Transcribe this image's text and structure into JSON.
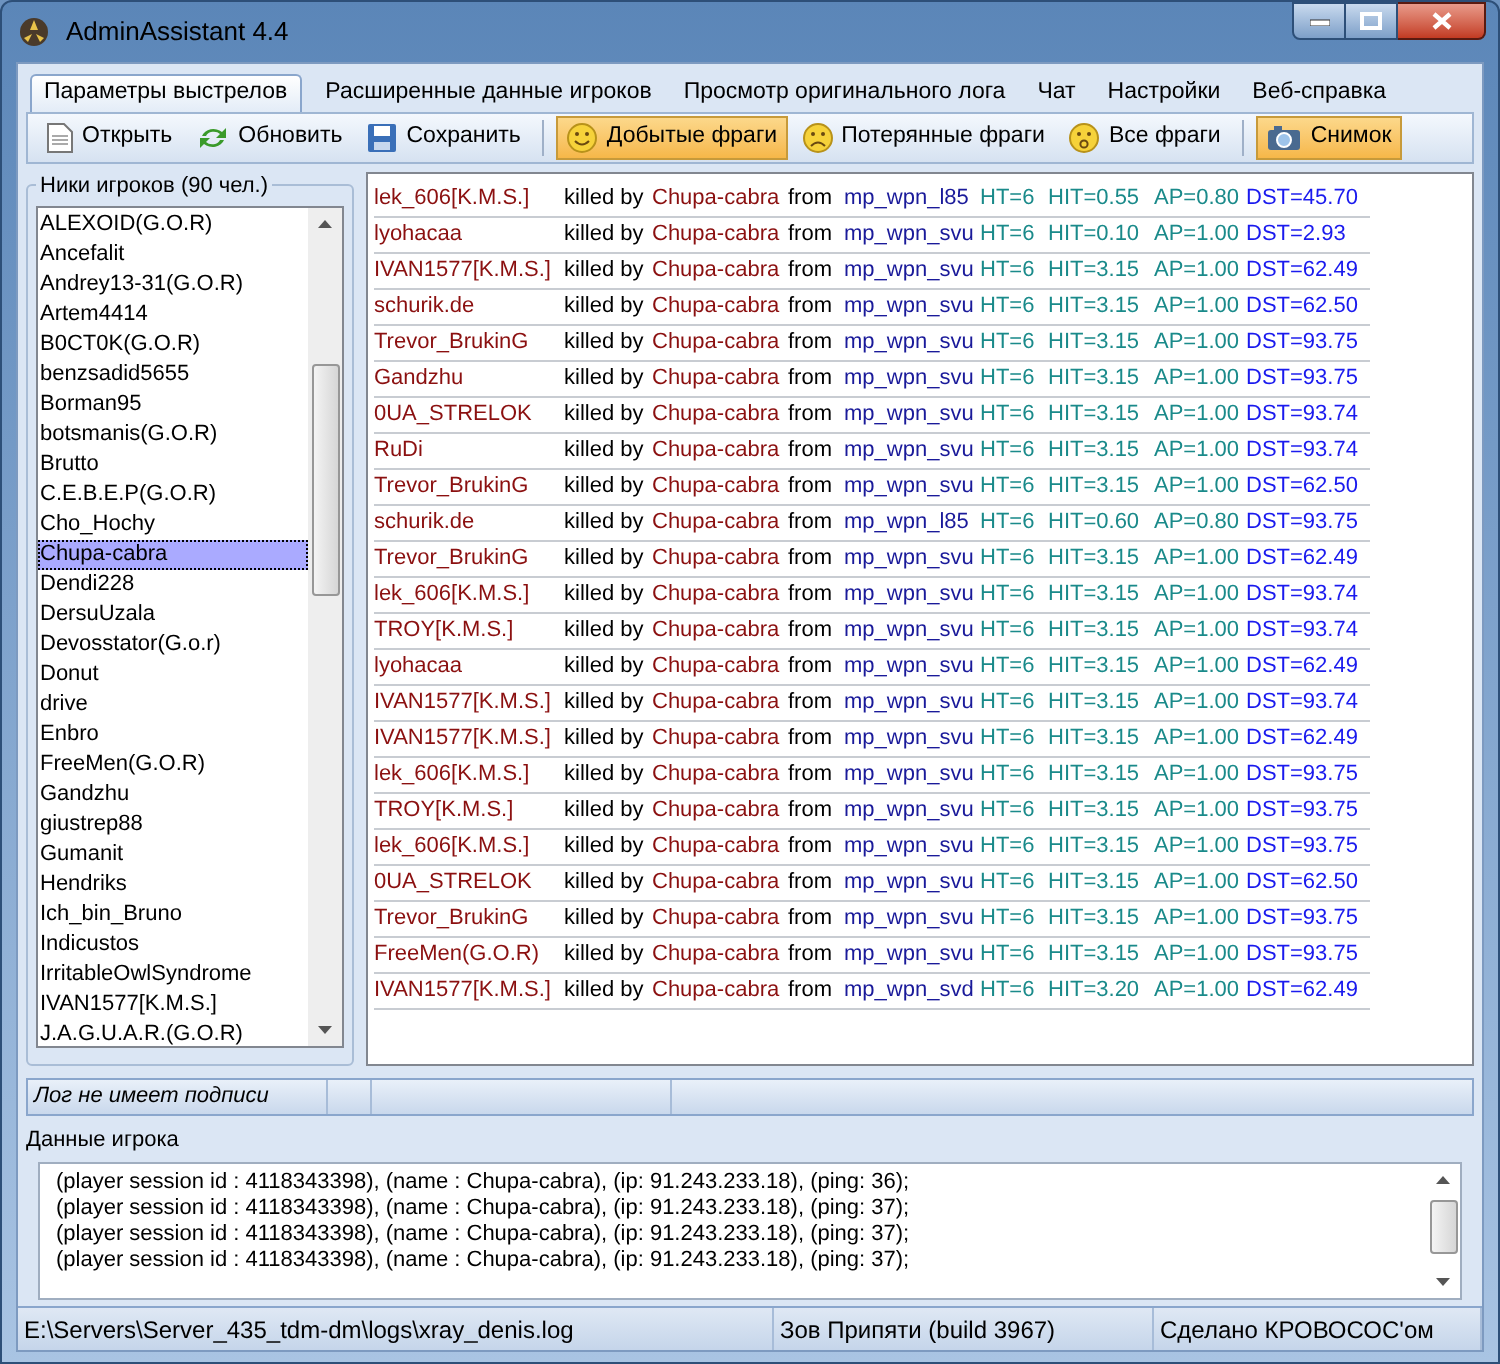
{
  "window": {
    "title": "AdminAssistant 4.4"
  },
  "tabs": [
    {
      "label": "Параметры выстрелов",
      "selected": true
    },
    {
      "label": "Расширенные данные игроков",
      "selected": false
    },
    {
      "label": "Просмотр оригинального лога",
      "selected": false
    },
    {
      "label": "Чат",
      "selected": false
    },
    {
      "label": "Настройки",
      "selected": false
    },
    {
      "label": "Веб-справка",
      "selected": false
    }
  ],
  "toolbar": [
    {
      "kind": "open",
      "label": "Открыть",
      "pressed": false
    },
    {
      "kind": "refresh",
      "label": "Обновить",
      "pressed": false
    },
    {
      "kind": "save",
      "label": "Сохранить",
      "pressed": false
    },
    {
      "kind": "separator"
    },
    {
      "kind": "happy",
      "label": "Добытые фраги",
      "pressed": true
    },
    {
      "kind": "sad",
      "label": "Потерянные фраги",
      "pressed": false
    },
    {
      "kind": "neutral",
      "label": "Все фраги",
      "pressed": false
    },
    {
      "kind": "separator"
    },
    {
      "kind": "camera",
      "label": "Снимок",
      "pressed": true
    }
  ],
  "players": {
    "title": "Ники игроков (90 чел.)",
    "items": [
      {
        "name": "ALEXOID(G.O.R)",
        "selected": false
      },
      {
        "name": "Ancefalit",
        "selected": false
      },
      {
        "name": "Andrey13-31(G.O.R)",
        "selected": false
      },
      {
        "name": "Artem4414",
        "selected": false
      },
      {
        "name": "B0CT0K(G.O.R)",
        "selected": false
      },
      {
        "name": "benzsadid5655",
        "selected": false
      },
      {
        "name": "Borman95",
        "selected": false
      },
      {
        "name": "botsmanis(G.O.R)",
        "selected": false
      },
      {
        "name": "Brutto",
        "selected": false
      },
      {
        "name": "C.E.B.E.P(G.O.R)",
        "selected": false
      },
      {
        "name": "Cho_Hochy",
        "selected": false
      },
      {
        "name": "Chupa-cabra",
        "selected": true
      },
      {
        "name": "Dendi228",
        "selected": false
      },
      {
        "name": "DersuUzala",
        "selected": false
      },
      {
        "name": "Devosstator(G.o.r)",
        "selected": false
      },
      {
        "name": "Donut",
        "selected": false
      },
      {
        "name": "drive",
        "selected": false
      },
      {
        "name": "Enbro",
        "selected": false
      },
      {
        "name": "FreeMen(G.O.R)",
        "selected": false
      },
      {
        "name": "Gandzhu",
        "selected": false
      },
      {
        "name": "giustrep88",
        "selected": false
      },
      {
        "name": "Gumanit",
        "selected": false
      },
      {
        "name": "Hendriks",
        "selected": false
      },
      {
        "name": "Ich_bin_Bruno",
        "selected": false
      },
      {
        "name": "Indicustos",
        "selected": false
      },
      {
        "name": "IrritableOwlSyndrome",
        "selected": false
      },
      {
        "name": "IVAN1577[K.M.S.]",
        "selected": false
      },
      {
        "name": "J.A.G.U.A.R.(G.O.R)",
        "selected": false
      }
    ]
  },
  "log": [
    [
      "lek_606[K.M.S.]",
      "killed by",
      "Chupa-cabra",
      "from",
      "mp_wpn_l85",
      "HT=6",
      "HIT=0.55",
      "AP=0.80",
      "DST=45.70"
    ],
    [
      "lyohacaa",
      "killed by",
      "Chupa-cabra",
      "from",
      "mp_wpn_svu",
      "HT=6",
      "HIT=0.10",
      "AP=1.00",
      "DST=2.93"
    ],
    [
      "IVAN1577[K.M.S.]",
      "killed by",
      "Chupa-cabra",
      "from",
      "mp_wpn_svu",
      "HT=6",
      "HIT=3.15",
      "AP=1.00",
      "DST=62.49"
    ],
    [
      "schurik.de",
      "killed by",
      "Chupa-cabra",
      "from",
      "mp_wpn_svu",
      "HT=6",
      "HIT=3.15",
      "AP=1.00",
      "DST=62.50"
    ],
    [
      "Trevor_BrukinG",
      "killed by",
      "Chupa-cabra",
      "from",
      "mp_wpn_svu",
      "HT=6",
      "HIT=3.15",
      "AP=1.00",
      "DST=93.75"
    ],
    [
      "Gandzhu",
      "killed by",
      "Chupa-cabra",
      "from",
      "mp_wpn_svu",
      "HT=6",
      "HIT=3.15",
      "AP=1.00",
      "DST=93.75"
    ],
    [
      "0UA_STRELOK",
      "killed by",
      "Chupa-cabra",
      "from",
      "mp_wpn_svu",
      "HT=6",
      "HIT=3.15",
      "AP=1.00",
      "DST=93.74"
    ],
    [
      "RuDi",
      "killed by",
      "Chupa-cabra",
      "from",
      "mp_wpn_svu",
      "HT=6",
      "HIT=3.15",
      "AP=1.00",
      "DST=93.74"
    ],
    [
      "Trevor_BrukinG",
      "killed by",
      "Chupa-cabra",
      "from",
      "mp_wpn_svu",
      "HT=6",
      "HIT=3.15",
      "AP=1.00",
      "DST=62.50"
    ],
    [
      "schurik.de",
      "killed by",
      "Chupa-cabra",
      "from",
      "mp_wpn_l85",
      "HT=6",
      "HIT=0.60",
      "AP=0.80",
      "DST=93.75"
    ],
    [
      "Trevor_BrukinG",
      "killed by",
      "Chupa-cabra",
      "from",
      "mp_wpn_svu",
      "HT=6",
      "HIT=3.15",
      "AP=1.00",
      "DST=62.49"
    ],
    [
      "lek_606[K.M.S.]",
      "killed by",
      "Chupa-cabra",
      "from",
      "mp_wpn_svu",
      "HT=6",
      "HIT=3.15",
      "AP=1.00",
      "DST=93.74"
    ],
    [
      "TROY[K.M.S.]",
      "killed by",
      "Chupa-cabra",
      "from",
      "mp_wpn_svu",
      "HT=6",
      "HIT=3.15",
      "AP=1.00",
      "DST=93.74"
    ],
    [
      "lyohacaa",
      "killed by",
      "Chupa-cabra",
      "from",
      "mp_wpn_svu",
      "HT=6",
      "HIT=3.15",
      "AP=1.00",
      "DST=62.49"
    ],
    [
      "IVAN1577[K.M.S.]",
      "killed by",
      "Chupa-cabra",
      "from",
      "mp_wpn_svu",
      "HT=6",
      "HIT=3.15",
      "AP=1.00",
      "DST=93.74"
    ],
    [
      "IVAN1577[K.M.S.]",
      "killed by",
      "Chupa-cabra",
      "from",
      "mp_wpn_svu",
      "HT=6",
      "HIT=3.15",
      "AP=1.00",
      "DST=62.49"
    ],
    [
      "lek_606[K.M.S.]",
      "killed by",
      "Chupa-cabra",
      "from",
      "mp_wpn_svu",
      "HT=6",
      "HIT=3.15",
      "AP=1.00",
      "DST=93.75"
    ],
    [
      "TROY[K.M.S.]",
      "killed by",
      "Chupa-cabra",
      "from",
      "mp_wpn_svu",
      "HT=6",
      "HIT=3.15",
      "AP=1.00",
      "DST=93.75"
    ],
    [
      "lek_606[K.M.S.]",
      "killed by",
      "Chupa-cabra",
      "from",
      "mp_wpn_svu",
      "HT=6",
      "HIT=3.15",
      "AP=1.00",
      "DST=93.75"
    ],
    [
      "0UA_STRELOK",
      "killed by",
      "Chupa-cabra",
      "from",
      "mp_wpn_svu",
      "HT=6",
      "HIT=3.15",
      "AP=1.00",
      "DST=62.50"
    ],
    [
      "Trevor_BrukinG",
      "killed by",
      "Chupa-cabra",
      "from",
      "mp_wpn_svu",
      "HT=6",
      "HIT=3.15",
      "AP=1.00",
      "DST=93.75"
    ],
    [
      "FreeMen(G.O.R)",
      "killed by",
      "Chupa-cabra",
      "from",
      "mp_wpn_svu",
      "HT=6",
      "HIT=3.15",
      "AP=1.00",
      "DST=93.75"
    ],
    [
      "IVAN1577[K.M.S.]",
      "killed by",
      "Chupa-cabra",
      "from",
      "mp_wpn_svd",
      "HT=6",
      "HIT=3.20",
      "AP=1.00",
      "DST=62.49"
    ]
  ],
  "signature_status": "Лог не имеет подписи",
  "player_data": {
    "title": "Данные игрока",
    "lines": [
      "(player session id : 4118343398), (name : Chupa-cabra), (ip: 91.243.233.18), (ping: 36);",
      "(player session id : 4118343398), (name : Chupa-cabra), (ip: 91.243.233.18), (ping: 37);",
      "(player session id : 4118343398), (name : Chupa-cabra), (ip: 91.243.233.18), (ping: 37);",
      "(player session id : 4118343398), (name : Chupa-cabra), (ip: 91.243.233.18), (ping: 37);"
    ]
  },
  "status_bar": [
    "E:\\Servers\\Server_435_tdm-dm\\logs\\xray_denis.log",
    "Зов Припяти (build 3967)",
    "Сделано КРОВОСОС'ом"
  ]
}
